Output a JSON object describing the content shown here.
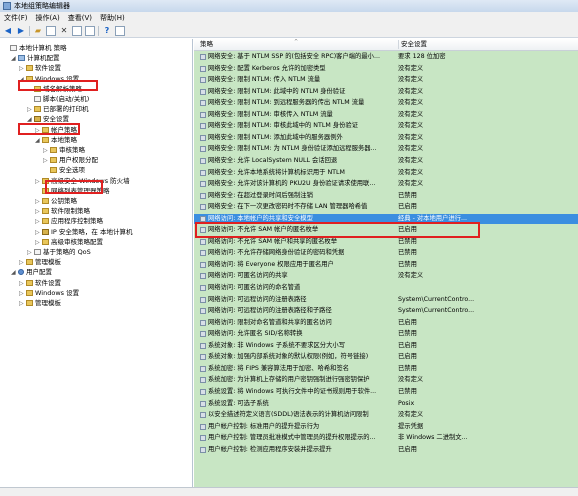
{
  "window": {
    "title": "本地组策略编辑器"
  },
  "menu": [
    "文件(F)",
    "操作(A)",
    "查看(V)",
    "帮助(H)"
  ],
  "toolbar": {
    "icons": [
      "back-arrow-icon",
      "forward-arrow-icon",
      "folder-up-icon",
      "show-hide-tree-icon",
      "delete-icon",
      "properties-icon",
      "export-icon",
      "help-icon",
      "view-icon"
    ]
  },
  "tree": [
    {
      "label": "本地计算机 策略",
      "indent": 0,
      "exp": "",
      "icon": "doc"
    },
    {
      "label": "计算机配置",
      "indent": 1,
      "exp": "◢",
      "icon": "pc"
    },
    {
      "label": "软件设置",
      "indent": 2,
      "exp": "▷",
      "icon": "folder"
    },
    {
      "label": "Windows 设置",
      "indent": 2,
      "exp": "◢",
      "icon": "folder"
    },
    {
      "label": "域名解析策略",
      "indent": 3,
      "exp": "",
      "icon": "folder"
    },
    {
      "label": "脚本(启动/关机)",
      "indent": 3,
      "exp": "",
      "icon": "doc"
    },
    {
      "label": "已部署的打印机",
      "indent": 3,
      "exp": "▷",
      "icon": "folder"
    },
    {
      "label": "安全设置",
      "indent": 3,
      "exp": "◢",
      "icon": "key"
    },
    {
      "label": "帐户策略",
      "indent": 4,
      "exp": "▷",
      "icon": "folder"
    },
    {
      "label": "本地策略",
      "indent": 4,
      "exp": "◢",
      "icon": "folder"
    },
    {
      "label": "审核策略",
      "indent": 5,
      "exp": "▷",
      "icon": "folder"
    },
    {
      "label": "用户权限分配",
      "indent": 5,
      "exp": "▷",
      "icon": "folder"
    },
    {
      "label": "安全选项",
      "indent": 5,
      "exp": "",
      "icon": "folder"
    },
    {
      "label": "高级安全 Windows 防火墙",
      "indent": 4,
      "exp": "▷",
      "icon": "folder"
    },
    {
      "label": "网络列表管理器策略",
      "indent": 4,
      "exp": "",
      "icon": "folder"
    },
    {
      "label": "公钥策略",
      "indent": 4,
      "exp": "▷",
      "icon": "folder"
    },
    {
      "label": "软件限制策略",
      "indent": 4,
      "exp": "▷",
      "icon": "folder"
    },
    {
      "label": "应用程序控制策略",
      "indent": 4,
      "exp": "▷",
      "icon": "folder"
    },
    {
      "label": "IP 安全策略，在 本地计算机",
      "indent": 4,
      "exp": "▷",
      "icon": "key"
    },
    {
      "label": "高级审核策略配置",
      "indent": 4,
      "exp": "▷",
      "icon": "folder"
    },
    {
      "label": "基于策略的 QoS",
      "indent": 3,
      "exp": "▷",
      "icon": "doc"
    },
    {
      "label": "管理模板",
      "indent": 2,
      "exp": "▷",
      "icon": "folder"
    },
    {
      "label": "用户配置",
      "indent": 1,
      "exp": "◢",
      "icon": "user"
    },
    {
      "label": "软件设置",
      "indent": 2,
      "exp": "▷",
      "icon": "folder"
    },
    {
      "label": "Windows 设置",
      "indent": 2,
      "exp": "▷",
      "icon": "folder"
    },
    {
      "label": "管理模板",
      "indent": 2,
      "exp": "▷",
      "icon": "folder"
    }
  ],
  "list": {
    "columns": [
      "策略",
      "安全设置"
    ],
    "rows": [
      {
        "policy": "网络安全: 基于 NTLM SSP 的(包括安全 RPC)客户端的最小...",
        "setting": "要求 128 位加密"
      },
      {
        "policy": "网络安全: 配置 Kerberos 允许的加密类型",
        "setting": "没有定义"
      },
      {
        "policy": "网络安全: 限制 NTLM: 传入 NTLM 流量",
        "setting": "没有定义"
      },
      {
        "policy": "网络安全: 限制 NTLM: 此域中的 NTLM 身份验证",
        "setting": "没有定义"
      },
      {
        "policy": "网络安全: 限制 NTLM: 到远程服务器的传出 NTLM 流量",
        "setting": "没有定义"
      },
      {
        "policy": "网络安全: 限制 NTLM: 审核传入 NTLM 流量",
        "setting": "没有定义"
      },
      {
        "policy": "网络安全: 限制 NTLM: 审核此域中的 NTLM 身份验证",
        "setting": "没有定义"
      },
      {
        "policy": "网络安全: 限制 NTLM: 添加此域中的服务器例外",
        "setting": "没有定义"
      },
      {
        "policy": "网络安全: 限制 NTLM: 为 NTLM 身份验证添加远程服务器...",
        "setting": "没有定义"
      },
      {
        "policy": "网络安全: 允许 LocalSystem NULL 会话回退",
        "setting": "没有定义"
      },
      {
        "policy": "网络安全: 允许本地系统将计算机标识用于 NTLM",
        "setting": "没有定义"
      },
      {
        "policy": "网络安全: 允许对该计算机的 PKU2U 身份验证请求使用联...",
        "setting": "没有定义"
      },
      {
        "policy": "网络安全: 在超过登录时间后强制注销",
        "setting": "已禁用"
      },
      {
        "policy": "网络安全: 在下一次更改密码时不存储 LAN 管理器哈希值",
        "setting": "已启用"
      },
      {
        "policy": "网络访问: 本地帐户的共享和安全模型",
        "setting": "经典 - 对本地用户进行..."
      },
      {
        "policy": "网络访问: 不允许 SAM 帐户的匿名枚举",
        "setting": "已启用"
      },
      {
        "policy": "网络访问: 不允许 SAM 帐户和共享的匿名枚举",
        "setting": "已禁用"
      },
      {
        "policy": "网络访问: 不允许存储网络身份验证的密码和凭据",
        "setting": "已禁用"
      },
      {
        "policy": "网络访问: 将 Everyone 权限应用于匿名用户",
        "setting": "已禁用"
      },
      {
        "policy": "网络访问: 可匿名访问的共享",
        "setting": "没有定义"
      },
      {
        "policy": "网络访问: 可匿名访问的命名管道",
        "setting": ""
      },
      {
        "policy": "网络访问: 可远程访问的注册表路径",
        "setting": "System\\CurrentContro..."
      },
      {
        "policy": "网络访问: 可远程访问的注册表路径和子路径",
        "setting": "System\\CurrentContro..."
      },
      {
        "policy": "网络访问: 限制对命名管道和共享的匿名访问",
        "setting": "已启用"
      },
      {
        "policy": "网络访问: 允许匿名 SID/名称转换",
        "setting": "已禁用"
      },
      {
        "policy": "系统对象: 非 Windows 子系统不要求区分大小写",
        "setting": "已启用"
      },
      {
        "policy": "系统对象: 加强内部系统对象的默认权限(例如，符号链接)",
        "setting": "已启用"
      },
      {
        "policy": "系统加密: 将 FIPS 兼容算法用于加密、哈希和签名",
        "setting": "已禁用"
      },
      {
        "policy": "系统加密: 为计算机上存储的用户密钥强制进行强密钥保护",
        "setting": "没有定义"
      },
      {
        "policy": "系统设置: 将 Windows 可执行文件中的证书规则用于软件...",
        "setting": "已禁用"
      },
      {
        "policy": "系统设置: 可选子系统",
        "setting": "Posix"
      },
      {
        "policy": "以安全描述符定义语言(SDDL)语法表示的计算机访问限制",
        "setting": "没有定义"
      },
      {
        "policy": "用户帐户控制: 标准用户的提升提示行为",
        "setting": "提示凭据"
      },
      {
        "policy": "用户帐户控制: 管理员批准模式中管理员的提升权限提示的...",
        "setting": "非 Windows 二进制文..."
      },
      {
        "policy": "用户帐户控制: 检测应用程序安装并提示提升",
        "setting": "已启用"
      }
    ]
  }
}
